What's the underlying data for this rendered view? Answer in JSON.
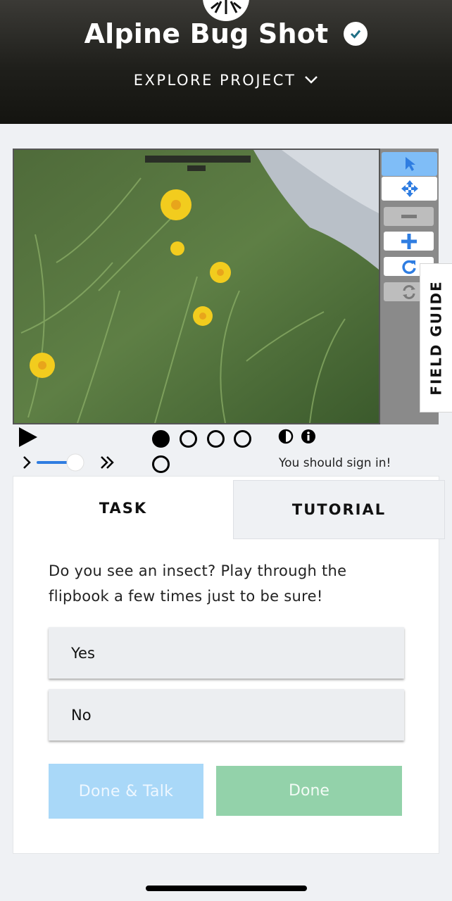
{
  "header": {
    "title": "Alpine Bug Shot",
    "explore_label": "EXPLORE PROJECT",
    "logo_icon": "bug-logo-icon",
    "verified_icon": "check-badge-icon"
  },
  "viewer": {
    "image_alt": "Alpine meadow with yellow flowers",
    "toolbar": [
      "pointer-icon",
      "move-icon",
      "zoom-out-icon",
      "zoom-in-icon",
      "rotate-icon",
      "reset-icon"
    ],
    "field_guide_label": "FIELD GUIDE",
    "frame_count": 5,
    "current_frame": 1,
    "sign_in_text": "You should sign in!",
    "colors": {
      "active_tool": "#7fbdf7",
      "icon_blue": "#2f7de1"
    }
  },
  "panel": {
    "tabs": {
      "task": "TASK",
      "tutorial": "TUTORIAL"
    },
    "question": "Do you see an insect? Play through the flipbook a few times just to be sure!",
    "answers": [
      "Yes",
      "No"
    ],
    "done_talk_label": "Done & Talk",
    "done_label": "Done",
    "colors": {
      "done_talk": "#a9d8f8",
      "done": "#93d2aa"
    }
  }
}
